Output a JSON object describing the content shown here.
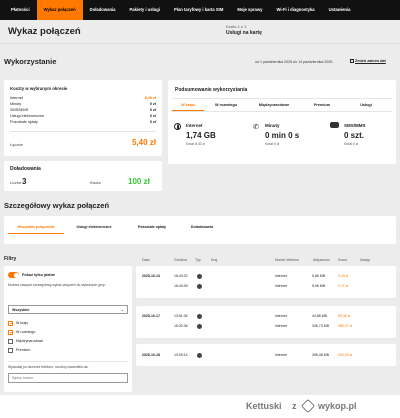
{
  "nav": [
    "Płatności",
    "Wykaz połączeń",
    "Doładowania",
    "Pakiety i usługi",
    "Plan taryfowy i karta SIM",
    "Moje sprawy",
    "Wi-Fi i diagnostyka",
    "Ustawienia"
  ],
  "header": {
    "title": "Wykaz połączeń",
    "account_line1": "Konto 1 z 1",
    "account_line2": "Usługi na kartę"
  },
  "usage": {
    "title": "Wykorzystanie",
    "period": "od 1 października 2025 do 14 października 2025",
    "change_link": "Zmień zakres dat",
    "costs": {
      "title": "Koszty w wybranym okresie",
      "rows": [
        {
          "label": "Internet",
          "value": "8,40 zł"
        },
        {
          "label": "Minuty",
          "value": "0 zł"
        },
        {
          "label": "SMS/MMS",
          "value": "0 zł"
        },
        {
          "label": "Usługi elektroniczne",
          "value": "0 zł"
        },
        {
          "label": "Pozostałe opłaty",
          "value": "0 zł"
        }
      ],
      "total_label": "Łącznie",
      "total_value": "5,40 zł"
    },
    "topups": {
      "title": "Doładowania",
      "count_label": "Liczba",
      "count": "3",
      "amount_label": "Kwota",
      "amount": "100 zł"
    },
    "summary": {
      "title": "Podsumowanie wykorzystania",
      "tabs": [
        "W kraju",
        "W roamingu",
        "Międzynarodowe",
        "Premium",
        "Usługi"
      ],
      "active_tab": "W kraju",
      "items": [
        {
          "icon": "globe-icon",
          "label": "Internet",
          "value": "1,74 GB",
          "cost": "Koszt 8,40 zł"
        },
        {
          "icon": "phone-icon",
          "label": "Minuty",
          "value": "0 min 0 s",
          "cost": "Koszt 0 zł"
        },
        {
          "icon": "chat-icon",
          "label": "SMS/MMS",
          "value": "0 szt.",
          "cost": "Koszt 0 zł"
        }
      ]
    }
  },
  "detail": {
    "title": "Szczegółowy wykaz połączeń",
    "tabs": [
      "Wszystkie połączenia",
      "Usługi elektroniczne",
      "Pozostałe opłaty",
      "Doładowania"
    ],
    "active_tab": "Wszystkie połączenia",
    "filters": {
      "title": "Filtry",
      "toggle_label": "Pokaż tylko płatne",
      "hint": "Możesz zawęzić szczegółowy wykaz połączeń do wybranych grup:",
      "select_value": "Wszystkie",
      "options": [
        {
          "label": "W kraju",
          "checked": true
        },
        {
          "label": "W roamingu",
          "checked": true
        },
        {
          "label": "Międzynarodowe",
          "checked": false
        },
        {
          "label": "Premium",
          "checked": false
        }
      ],
      "search_hint": "Wyszukaj po numerze telefonu, na który dzwoniłeś/-aś:",
      "search_placeholder": "Wpisz numer"
    },
    "columns": [
      "Data",
      "Godzina",
      "Typ",
      "Kraj",
      "Numer telefonu",
      "Aktywność",
      "Koszt",
      "Uwagi"
    ],
    "groups": [
      {
        "date": "2025-10-13",
        "rows": [
          {
            "time": "16:43:02",
            "number": "Internet",
            "activity": "5,86 MB",
            "cost": "0,49 zł"
          },
          {
            "time": "16:43:09",
            "number": "Internet",
            "activity": "5,96 MB",
            "cost": "0,71 zł"
          }
        ]
      },
      {
        "date": "2025-10-17",
        "rows": [
          {
            "time": "13:51:04",
            "number": "Internet",
            "activity": "44,88 MB",
            "cost": "55,36 zł"
          },
          {
            "time": "16:32:35",
            "number": "Internet",
            "activity": "336,73 MB",
            "cost": "385,37 zł"
          }
        ]
      },
      {
        "date": "2025-10-18",
        "rows": [
          {
            "time": "13:09:14",
            "number": "Internet",
            "activity": "396,48 MB",
            "cost": "334,25 zł"
          }
        ]
      }
    ]
  },
  "watermark": {
    "text1": "Kettuski",
    "text2": "z",
    "logo": "wykop.pl"
  },
  "colors": {
    "accent": "#ff7900",
    "green": "#32c832",
    "nav_bg": "#111111"
  }
}
